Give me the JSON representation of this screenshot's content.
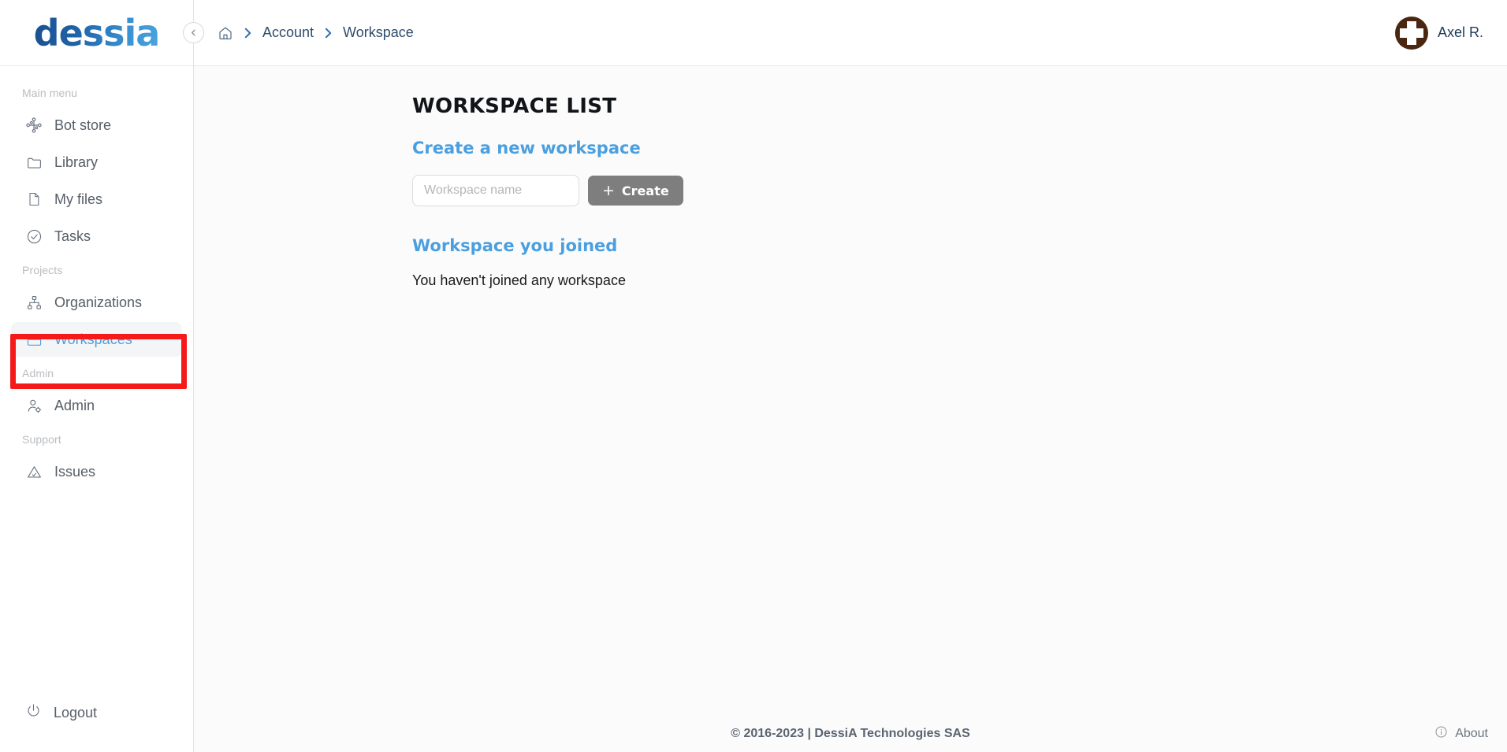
{
  "brand": {
    "logo_text": "dessia"
  },
  "topbar": {
    "breadcrumb": [
      {
        "icon": "home-icon",
        "label": ""
      },
      {
        "icon": "",
        "label": "Account"
      },
      {
        "icon": "",
        "label": "Workspace"
      }
    ],
    "separator": "›",
    "collapse_icon": "chevron-left-icon",
    "user": {
      "name": "Axel R.",
      "avatar_icon": "cross-avatar-icon",
      "avatar_color": "#4b2712"
    }
  },
  "sidebar": {
    "sections": [
      {
        "label": "Main menu",
        "items": [
          {
            "label": "Bot store",
            "icon": "nodes-network-icon",
            "active": false
          },
          {
            "label": "Library",
            "icon": "folder-icon",
            "active": false
          },
          {
            "label": "My files",
            "icon": "document-icon",
            "active": false
          },
          {
            "label": "Tasks",
            "icon": "check-circle-icon",
            "active": false
          }
        ]
      },
      {
        "label": "Projects",
        "items": [
          {
            "label": "Organizations",
            "icon": "org-tree-icon",
            "active": false
          },
          {
            "label": "Workspaces",
            "icon": "briefcase-icon",
            "active": true
          }
        ]
      },
      {
        "label": "Admin",
        "items": [
          {
            "label": "Admin",
            "icon": "user-gear-icon",
            "active": false
          }
        ]
      },
      {
        "label": "Support",
        "items": [
          {
            "label": "Issues",
            "icon": "warning-triangle-icon",
            "active": false
          }
        ]
      }
    ],
    "logout": {
      "label": "Logout",
      "icon": "power-icon"
    }
  },
  "main": {
    "page_title": "WORKSPACE LIST",
    "create_section": {
      "heading": "Create a new workspace",
      "input_placeholder": "Workspace name",
      "input_value": "",
      "button_label": "Create",
      "button_icon": "plus-icon"
    },
    "joined_section": {
      "heading": "Workspace you joined",
      "empty_message": "You haven't joined any workspace"
    }
  },
  "footer": {
    "copyright": "© 2016-2023 | DessiA Technologies SAS",
    "about_label": "About",
    "about_icon": "info-circle-icon"
  },
  "annotation": {
    "target": "Workspaces",
    "color": "#f51a1a"
  },
  "colors": {
    "accent_blue": "#4a9fe0",
    "button_gray": "#7e7e7e",
    "text_dark": "#111418"
  }
}
